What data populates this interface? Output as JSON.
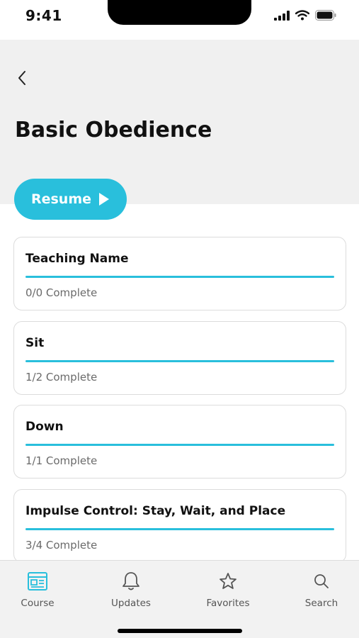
{
  "status_bar": {
    "time": "9:41"
  },
  "header": {
    "title": "Basic Obedience"
  },
  "resume_button": {
    "label": "Resume"
  },
  "lessons": [
    {
      "title": "Teaching Name",
      "status": "0/0 Complete",
      "progress": 1.0
    },
    {
      "title": "Sit",
      "status": "1/2 Complete",
      "progress": 1.0
    },
    {
      "title": "Down",
      "status": "1/1 Complete",
      "progress": 1.0
    },
    {
      "title": "Impulse Control: Stay, Wait, and Place",
      "status": "3/4 Complete",
      "progress": 1.0
    }
  ],
  "tab_bar": {
    "items": [
      {
        "label": "Course",
        "icon": "course-icon",
        "active": true
      },
      {
        "label": "Updates",
        "icon": "bell-icon",
        "active": false
      },
      {
        "label": "Favorites",
        "icon": "star-icon",
        "active": false
      },
      {
        "label": "Search",
        "icon": "search-icon",
        "active": false
      }
    ]
  },
  "colors": {
    "accent": "#29bfdc",
    "header_bg": "#f0f0f0",
    "text": "#111111",
    "muted": "#6a6a6a"
  }
}
